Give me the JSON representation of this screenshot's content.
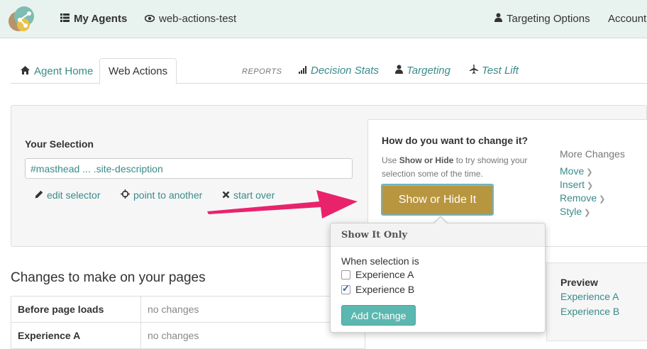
{
  "nav": {
    "my_agents": "My Agents",
    "agent_name": "web-actions-test",
    "targeting_options": "Targeting Options",
    "account": "Account"
  },
  "tabs": {
    "agent_home": "Agent Home",
    "web_actions": "Web Actions",
    "reports_label": "REPORTS",
    "decision_stats": "Decision Stats",
    "targeting": "Targeting",
    "test_lift": "Test Lift"
  },
  "selection": {
    "title": "Your Selection",
    "value": "#masthead ... .site-description",
    "edit_selector": "edit selector",
    "point_to_another": "point to another",
    "start_over": "start over"
  },
  "change": {
    "title": "How do you want to change it?",
    "help_prefix": "Use ",
    "help_bold": "Show or Hide",
    "help_suffix": " to try showing your selection some of the time.",
    "show_hide_button": "Show or Hide It",
    "more_title": "More Changes",
    "more": [
      "Move",
      "Insert",
      "Remove",
      "Style"
    ]
  },
  "popover": {
    "title": "Show It Only",
    "when_label": "When selection is",
    "options": [
      {
        "label": "Experience A",
        "checked": false
      },
      {
        "label": "Experience B",
        "checked": true
      }
    ],
    "add_button": "Add Change"
  },
  "changes": {
    "title": "Changes to make on your pages",
    "rows": [
      {
        "label": "Before page loads",
        "value": "no changes"
      },
      {
        "label": "Experience A",
        "value": "no changes"
      }
    ]
  },
  "preview": {
    "title": "Preview",
    "links": [
      "Experience A",
      "Experience B"
    ]
  },
  "colors": {
    "accent_teal": "#3a8a8a",
    "show_button_gold": "#b8963f",
    "add_button_teal": "#5bb8b0",
    "arrow_pink": "#e8236c",
    "topbar_bg": "#e8f2ef"
  }
}
